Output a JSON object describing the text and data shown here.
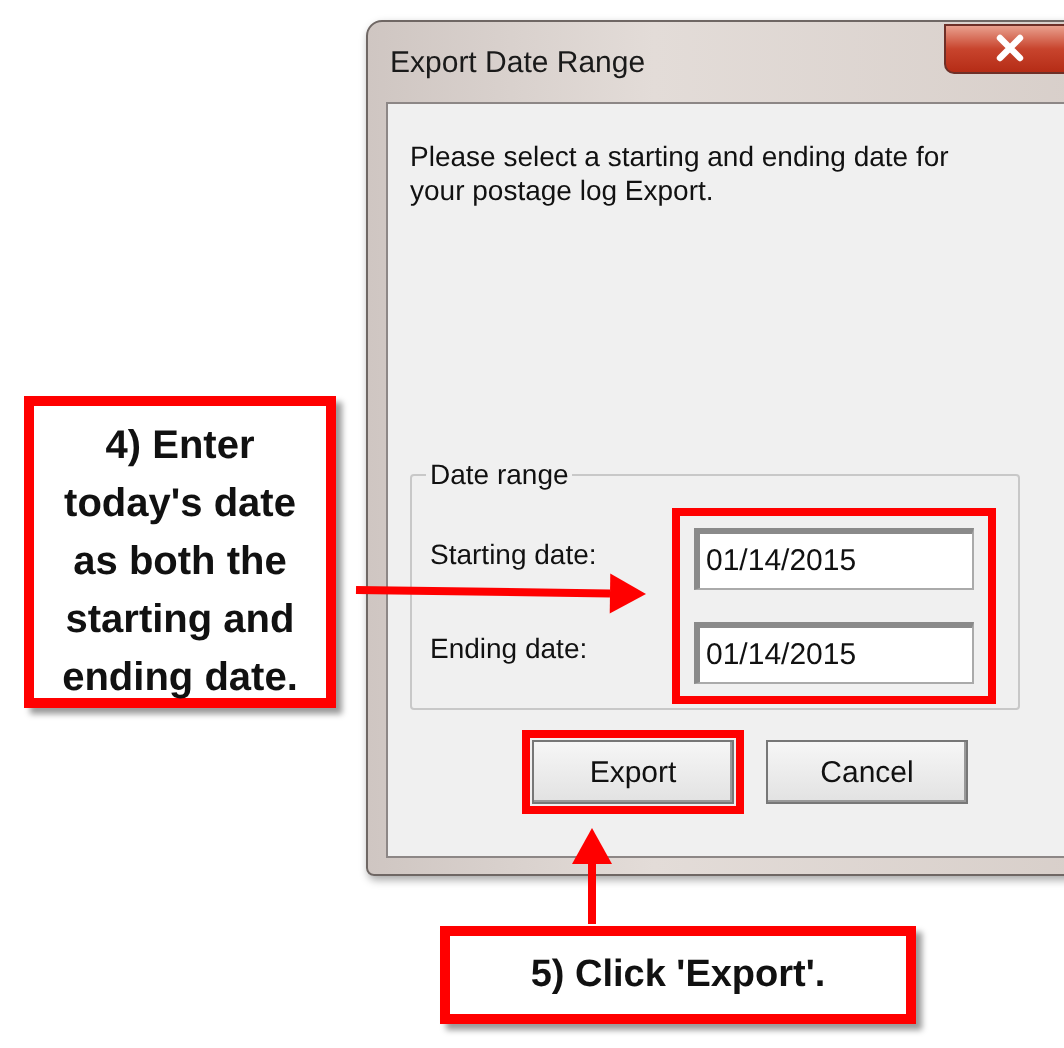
{
  "window": {
    "title": "Export Date Range"
  },
  "instructions": "Please select a starting and ending date for your postage log Export.",
  "date_range": {
    "label": "Date range",
    "highlighted": true,
    "fields": [
      {
        "label": "Starting date:",
        "value": "01/14/2015"
      },
      {
        "label": "Ending date:",
        "value": "01/14/2015"
      }
    ]
  },
  "buttons": [
    {
      "label": "Export",
      "highlighted": true
    },
    {
      "label": "Cancel",
      "highlighted": false
    }
  ],
  "callouts": [
    {
      "text": "4) Enter today's date as both the starting and ending date."
    },
    {
      "text": "5) Click 'Export'."
    }
  ]
}
